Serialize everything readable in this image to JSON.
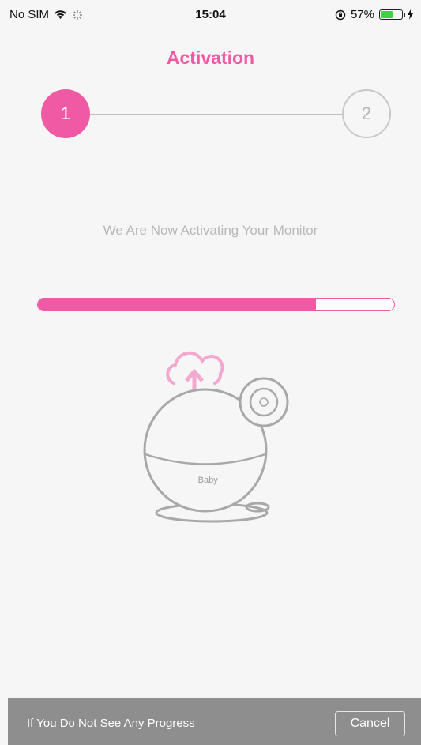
{
  "status_bar": {
    "carrier": "No SIM",
    "time": "15:04",
    "battery": "57%",
    "battery_level": 0.57,
    "battery_color": "#3fd33f"
  },
  "header": {
    "title": "Activation"
  },
  "stepper": {
    "steps": [
      {
        "label": "1",
        "state": "active"
      },
      {
        "label": "2",
        "state": "inactive"
      }
    ]
  },
  "main": {
    "message": "We Are Now Activating Your Monitor",
    "progress": 0.78,
    "device_brand": "iBaby"
  },
  "footer": {
    "help_text": "If You Do Not See Any Progress",
    "cancel_label": "Cancel"
  },
  "colors": {
    "accent": "#f05aa4",
    "footer_bg": "#8e8e8e"
  },
  "icons": [
    "wifi-icon",
    "loading-spinner-icon",
    "rotation-lock-icon",
    "battery-icon",
    "charging-icon",
    "cloud-upload-icon",
    "camera-illustration"
  ]
}
